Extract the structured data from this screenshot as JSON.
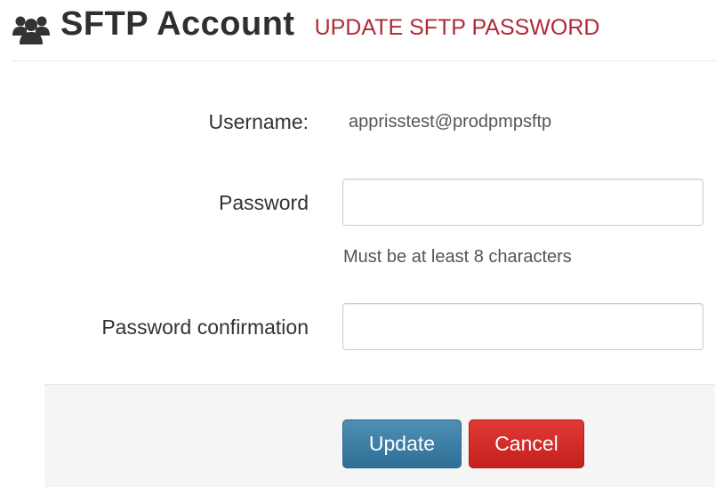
{
  "header": {
    "icon": "users-icon",
    "title": "SFTP Account",
    "subtitle": "UPDATE SFTP PASSWORD"
  },
  "form": {
    "username_label": "Username:",
    "username_value": "apprisstest@prodpmpsftp",
    "password_label": "Password",
    "password_value": "",
    "password_help": "Must be at least 8 characters",
    "confirmation_label": "Password confirmation",
    "confirmation_value": ""
  },
  "actions": {
    "update_label": "Update",
    "cancel_label": "Cancel"
  },
  "colors": {
    "subtitle": "#b02a37",
    "update_button": "#3a7ca5",
    "cancel_button": "#d42a25"
  }
}
